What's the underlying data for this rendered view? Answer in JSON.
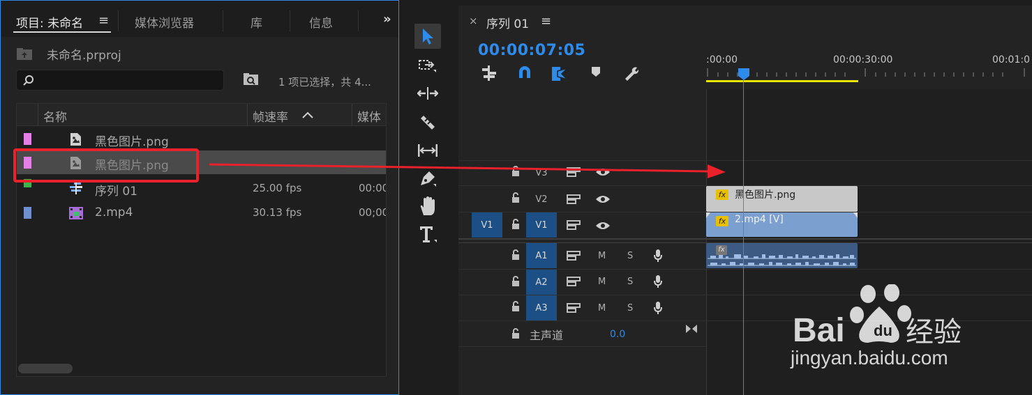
{
  "project_panel": {
    "tabs": [
      {
        "label": "项目: 未命名",
        "active": true
      },
      {
        "label": "媒体浏览器",
        "active": false
      },
      {
        "label": "库",
        "active": false
      },
      {
        "label": "信息",
        "active": false
      }
    ],
    "tab_menu": "≡",
    "overflow": "»",
    "project_file": "未命名.prproj",
    "search": {
      "value": "",
      "placeholder": ""
    },
    "status": "1 项已选择，共 4...",
    "columns": {
      "name": "名称",
      "frame_rate": "帧速率",
      "media": "媒体"
    },
    "items": [
      {
        "name": "黑色图片.png",
        "fps": "",
        "media": "",
        "label_color": "#e47fe6",
        "icon": "still-image-icon",
        "selected": false
      },
      {
        "name": "黑色图片.png",
        "fps": "",
        "media": "",
        "label_color": "#e47fe6",
        "icon": "still-image-icon",
        "selected": true
      },
      {
        "name": "序列 01",
        "fps": "25.00 fps",
        "media": "00:00",
        "label_color": "#3fb24c",
        "icon": "sequence-icon",
        "selected": false
      },
      {
        "name": "2.mp4",
        "fps": "30.13 fps",
        "media": "00;00",
        "label_color": "#6f8fcf",
        "icon": "video-clip-icon",
        "selected": false
      }
    ]
  },
  "tools": [
    "selection-tool",
    "track-select-tool",
    "ripple-edit-tool",
    "razor-tool",
    "slip-tool",
    "pen-tool",
    "hand-tool",
    "type-tool"
  ],
  "timeline": {
    "close": "×",
    "title": "序列 01",
    "menu": "≡",
    "timecode": "00:00:07:05",
    "ruler": [
      ":00:00",
      "00:00:30:00",
      "00:01:0"
    ],
    "tracks": {
      "video": [
        {
          "label": "V3",
          "source": "",
          "targeted": false
        },
        {
          "label": "V2",
          "source": "",
          "targeted": false
        },
        {
          "label": "V1",
          "source": "V1",
          "targeted": true
        }
      ],
      "audio": [
        {
          "label": "A1",
          "mute": "M",
          "solo": "S"
        },
        {
          "label": "A2",
          "mute": "M",
          "solo": "S"
        },
        {
          "label": "A3",
          "mute": "M",
          "solo": "S"
        }
      ]
    },
    "master": {
      "label": "主声道",
      "value": "0.0"
    },
    "clips": {
      "v2": {
        "fx": "fx",
        "name": "黑色图片.png"
      },
      "v1": {
        "fx": "fx",
        "name": "2.mp4 [V]"
      },
      "a1": {
        "fx": "fx"
      }
    }
  },
  "colors": {
    "accent": "#2d8ceb",
    "highlight": "#e8212b",
    "work_area": "#e7e600"
  },
  "watermark": {
    "text": "jingyan.baidu.com",
    "brand": "Baidu经验"
  }
}
